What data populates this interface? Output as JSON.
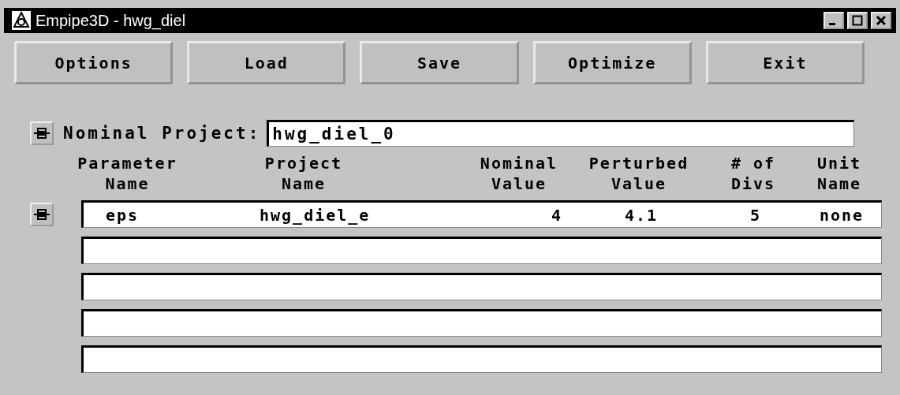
{
  "window": {
    "title": "Empipe3D - hwg_diel"
  },
  "toolbar": [
    {
      "label": "Options"
    },
    {
      "label": "Load"
    },
    {
      "label": "Save"
    },
    {
      "label": "Optimize"
    },
    {
      "label": "Exit"
    }
  ],
  "nominal_project": {
    "label": "Nominal Project:",
    "value": "hwg_diel_0"
  },
  "table": {
    "columns": [
      "Parameter Name",
      "Project Name",
      "Nominal Value",
      "Perturbed Value",
      "# of Divs",
      "Unit Name"
    ],
    "rows": [
      {
        "cells": [
          "eps",
          "hwg_diel_e",
          "4",
          "4.1",
          "5",
          "none"
        ]
      },
      {
        "cells": []
      },
      {
        "cells": []
      },
      {
        "cells": []
      },
      {
        "cells": []
      }
    ]
  }
}
